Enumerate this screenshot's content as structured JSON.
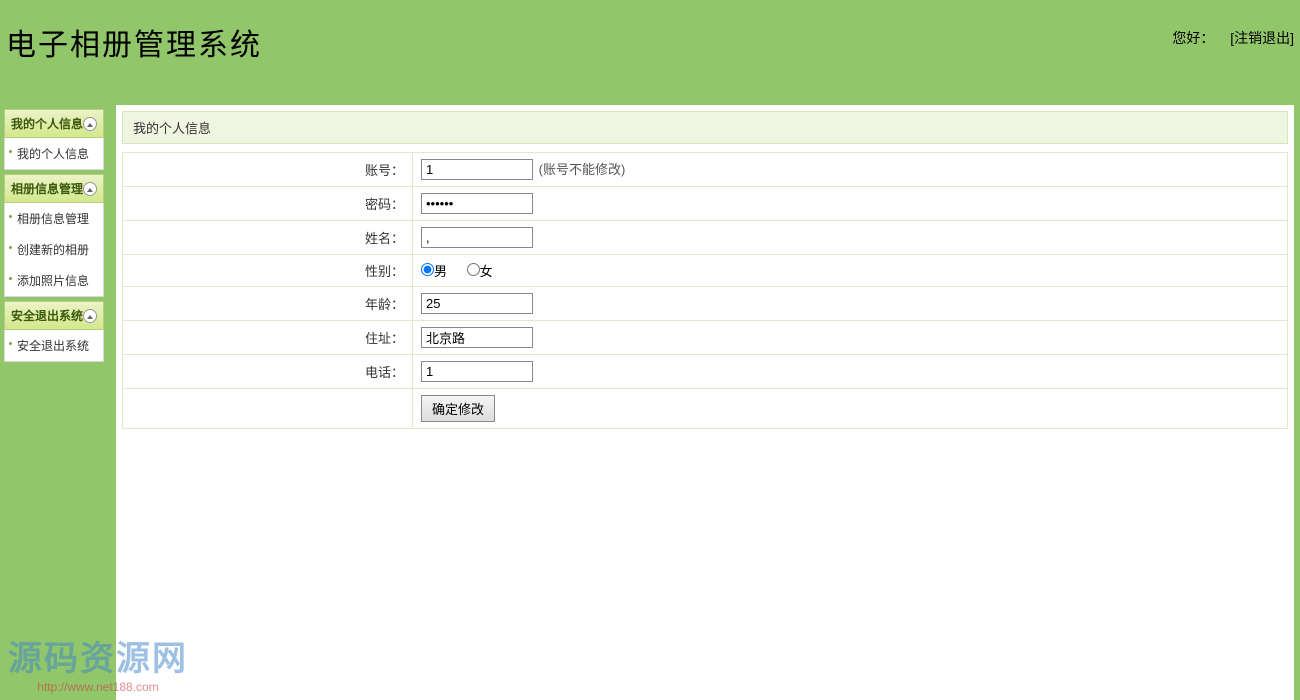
{
  "header": {
    "title": "电子相册管理系统",
    "greeting": "您好：",
    "logout": "[注销退出]"
  },
  "sidebar": {
    "groups": [
      {
        "title": "我的个人信息",
        "items": [
          "我的个人信息"
        ]
      },
      {
        "title": "相册信息管理",
        "items": [
          "相册信息管理",
          "创建新的相册",
          "添加照片信息"
        ]
      },
      {
        "title": "安全退出系统",
        "items": [
          "安全退出系统"
        ]
      }
    ]
  },
  "panel": {
    "title": "我的个人信息"
  },
  "form": {
    "labels": {
      "account": "账号：",
      "password": "密码：",
      "name": "姓名：",
      "gender": "性别：",
      "age": "年龄：",
      "address": "住址：",
      "phone": "电话："
    },
    "values": {
      "account": "1",
      "password": "••••••",
      "name": ",",
      "gender": "male",
      "age": "25",
      "address": "北京路",
      "phone": "1"
    },
    "account_note": "(账号不能修改)",
    "gender_options": {
      "male": "男",
      "female": "女"
    },
    "submit": "确定修改"
  },
  "watermark": {
    "text": "源码资源网",
    "url": "http://www.net188.com"
  }
}
